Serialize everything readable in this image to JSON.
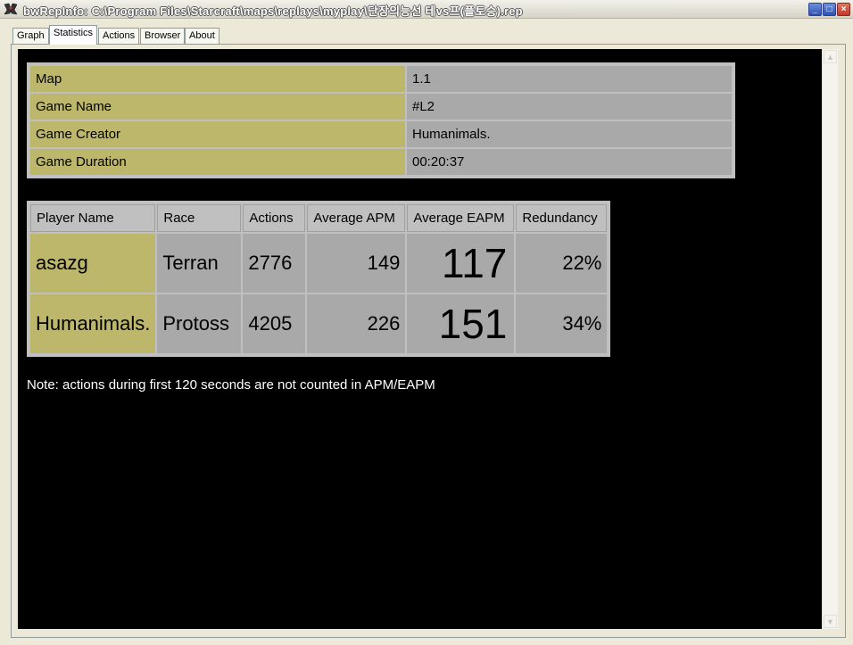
{
  "window": {
    "title": "bwRepInfo: C:\\Program Files\\Starcraft\\maps\\replays\\myplay\\단장의능선 테vs프(플토승).rep",
    "minimize": "_",
    "maximize": "□",
    "close": "×"
  },
  "tabs": [
    "Graph",
    "Statistics",
    "Actions",
    "Browser",
    "About"
  ],
  "active_tab": "Statistics",
  "game_info": [
    {
      "label": "Map",
      "value": "1.1"
    },
    {
      "label": "Game Name",
      "value": "#L2"
    },
    {
      "label": "Game Creator",
      "value": "Humanimals."
    },
    {
      "label": "Game Duration",
      "value": "00:20:37"
    }
  ],
  "players": {
    "headers": [
      "Player Name",
      "Race",
      "Actions",
      "Average APM",
      "Average EAPM",
      "Redundancy"
    ],
    "rows": [
      {
        "name": "asazg",
        "race": "Terran",
        "actions": "2776",
        "apm": "149",
        "eapm": "117",
        "redundancy": "22%"
      },
      {
        "name": "Humanimals.",
        "race": "Protoss",
        "actions": "4205",
        "apm": "226",
        "eapm": "151",
        "redundancy": "34%"
      }
    ]
  },
  "note": "Note: actions during first 120 seconds are not counted in APM/EAPM",
  "colors": {
    "key_cell": "#bdb76b",
    "value_cell": "#a9a9a9",
    "background": "#000000"
  }
}
